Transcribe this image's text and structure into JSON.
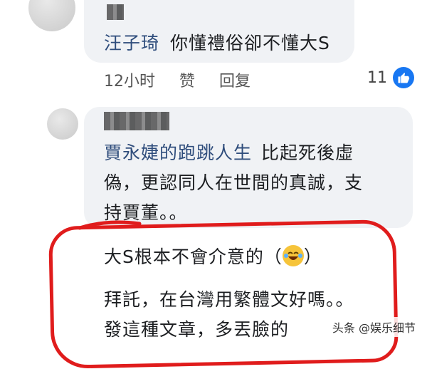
{
  "comment1": {
    "author": "汪子琦",
    "text": "你懂禮俗卻不懂大S",
    "time": "12小时",
    "like_label": "赞",
    "reply_label": "回复",
    "like_count": "11"
  },
  "comment2": {
    "author": "賈永婕的跑跳人生",
    "line1": "比起死後虛",
    "line2": "偽，更認同人在世間的真誠，支",
    "line3": "持賈董。。"
  },
  "comment3": {
    "line1": "大S根本不會介意的（",
    "line1_end": "）",
    "line2": "拜託，在台灣用繁體文好嗎。。",
    "line3": "發這種文章，多丟臉的"
  },
  "watermark": "头条 @娱乐细节",
  "colors": {
    "accent": "#1877f2",
    "annotation": "#e01c1c",
    "name": "#2f4d7c"
  },
  "icons": {
    "like": "thumbs-up-icon",
    "emoji": "laughing-tears-emoji-icon"
  }
}
